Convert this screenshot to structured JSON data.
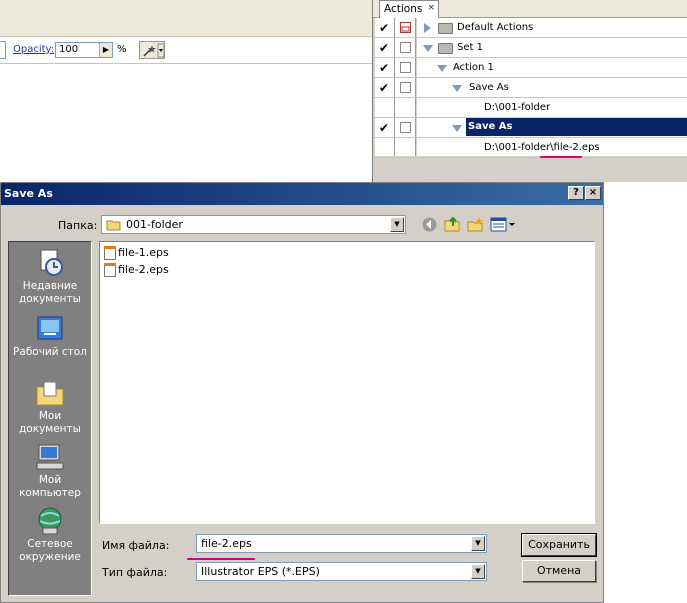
{
  "toolbar": {
    "opacity_label": "Opacity:",
    "opacity_value": "100",
    "opacity_unit": "%"
  },
  "actions_panel": {
    "tab_label": "Actions",
    "tab_close": "×",
    "rows": [
      {
        "label": "Default Actions"
      },
      {
        "label": "Set 1"
      },
      {
        "label": "Action 1"
      },
      {
        "label": "Save As"
      },
      {
        "label": "D:\\001-folder"
      },
      {
        "label": "Save As"
      },
      {
        "label": "D:\\001-folder\\file-2.eps"
      }
    ],
    "highlight_color": "#d6007a"
  },
  "dialog": {
    "title": "Save As",
    "help_btn": "?",
    "close_btn": "×",
    "lookin_label": "Папка:",
    "lookin_value": "001-folder",
    "places": [
      {
        "label": "Недавние документы"
      },
      {
        "label": "Рабочий стол"
      },
      {
        "label": "Мои документы"
      },
      {
        "label": "Мой компьютер"
      },
      {
        "label": "Сетевое окружение"
      }
    ],
    "files": [
      {
        "name": "file-1.eps"
      },
      {
        "name": "file-2.eps"
      }
    ],
    "filename_label": "Имя файла:",
    "filename_value": "file-2.eps",
    "filetype_label": "Тип файла:",
    "filetype_value": "Illustrator EPS (*.EPS)",
    "save_btn": "Сохранить",
    "cancel_btn": "Отмена"
  }
}
